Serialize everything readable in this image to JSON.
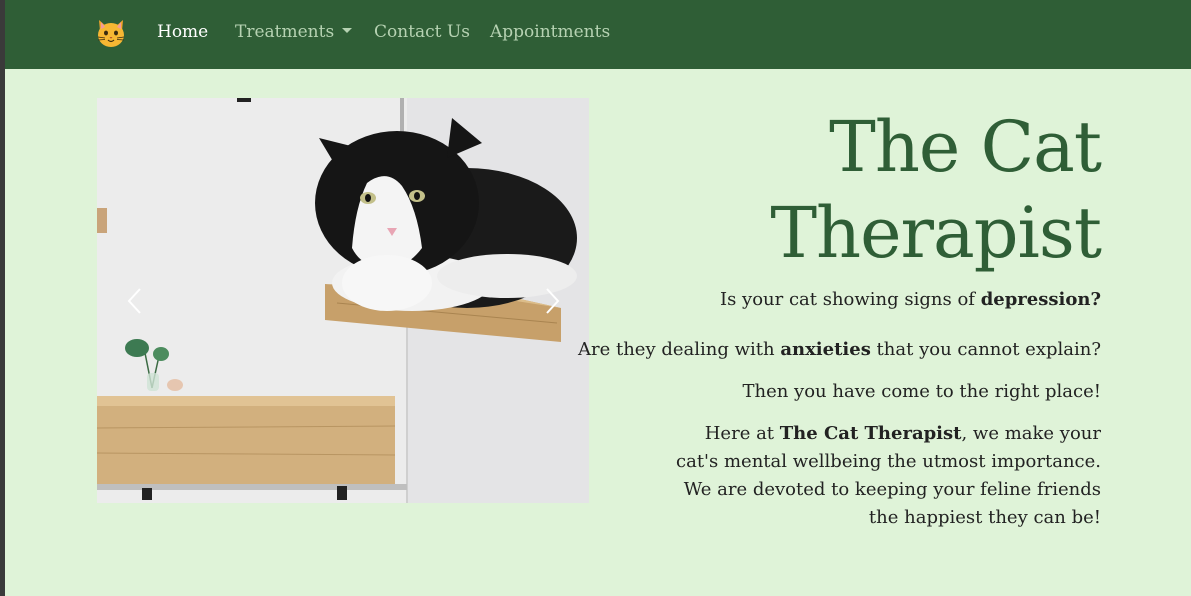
{
  "nav": {
    "logo_icon": "cat-face-icon",
    "items": [
      {
        "label": "Home",
        "active": true
      },
      {
        "label": "Treatments",
        "dropdown": true
      },
      {
        "label": "Contact Us"
      },
      {
        "label": "Appointments"
      }
    ]
  },
  "carousel": {
    "image_subject": "black-and-white-cat-on-wall-shelf",
    "prev_icon": "chevron-left-icon",
    "next_icon": "chevron-right-icon"
  },
  "hero": {
    "title_line1": "The Cat",
    "title_line2": "Therapist",
    "p1_pre": "Is your cat showing signs of ",
    "p1_bold": "depression?",
    "p2_pre": "Are they dealing with ",
    "p2_bold": "anxieties",
    "p2_post": " that you cannot explain?",
    "p3": "Then you have come to the right place!",
    "p4_pre": "Here at ",
    "p4_bold": "The Cat Therapist",
    "p4_post": ", we make your cat's mental wellbeing the utmost importance. We are devoted to keeping your feline friends the happiest they can be!"
  },
  "colors": {
    "navbar": "#2f5e36",
    "page_bg": "#dff3d8",
    "title": "#2f5e36",
    "nav_link": "#b6d2b2",
    "nav_active": "#ffffff"
  }
}
